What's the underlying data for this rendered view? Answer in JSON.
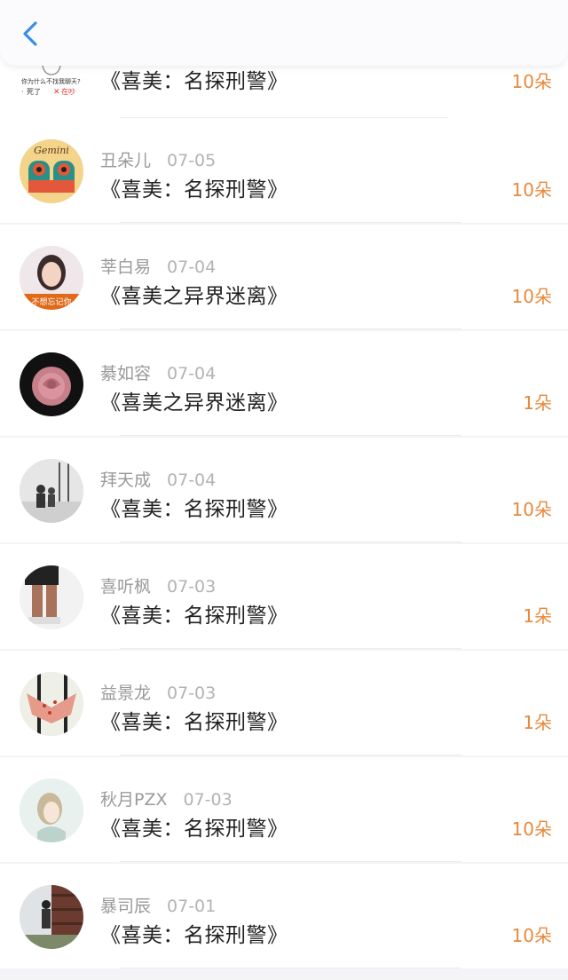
{
  "nav": {
    "back_icon": "chevron-left-icon",
    "accent": "#3a8ee6"
  },
  "partial_item": {
    "thumb_line1": "你为什么不找我聊天?",
    "thumb_line2": "死了",
    "thumb_line3": "在吵",
    "book": "《喜美：名探刑警》",
    "count": "10朵"
  },
  "items": [
    {
      "name": "丑朵儿",
      "date": "07-05",
      "book": "《喜美：名探刑警》",
      "count": "10朵"
    },
    {
      "name": "莘白易",
      "date": "07-04",
      "book": "《喜美之异界迷离》",
      "count": "10朵",
      "avatar_text": "不想忘记你"
    },
    {
      "name": "綦如容",
      "date": "07-04",
      "book": "《喜美之异界迷离》",
      "count": "1朵"
    },
    {
      "name": "拜天成",
      "date": "07-04",
      "book": "《喜美：名探刑警》",
      "count": "10朵"
    },
    {
      "name": "喜听枫",
      "date": "07-03",
      "book": "《喜美：名探刑警》",
      "count": "1朵"
    },
    {
      "name": "益景龙",
      "date": "07-03",
      "book": "《喜美：名探刑警》",
      "count": "1朵"
    },
    {
      "name": "秋月PZX",
      "date": "07-03",
      "book": "《喜美：名探刑警》",
      "count": "10朵"
    },
    {
      "name": "暴司辰",
      "date": "07-01",
      "book": "《喜美：名探刑警》",
      "count": "10朵"
    }
  ],
  "avatar_gemini_text": "Gemini",
  "colors": {
    "count": "#e8893c",
    "name": "#9a9a9a",
    "title": "#222222"
  }
}
